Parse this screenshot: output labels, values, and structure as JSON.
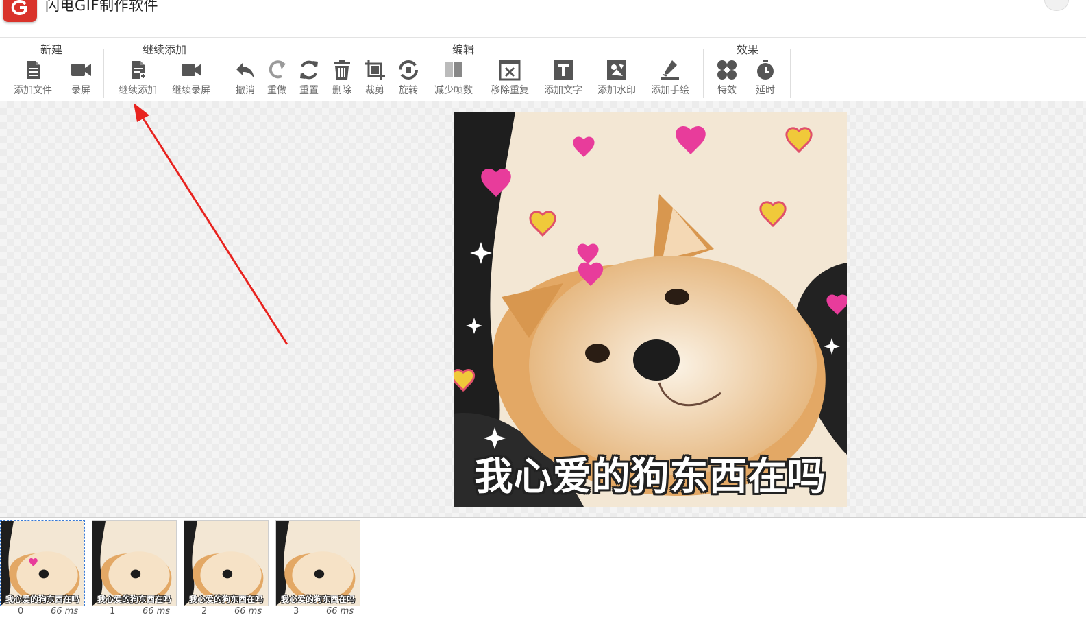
{
  "app": {
    "title": "闪电GIF制作软件"
  },
  "toolbar": {
    "groups": [
      {
        "title": "新建",
        "tools": [
          {
            "label": "添加文件",
            "icon": "file-icon"
          },
          {
            "label": "录屏",
            "icon": "camera-icon"
          }
        ]
      },
      {
        "title": "继续添加",
        "tools": [
          {
            "label": "继续添加",
            "icon": "file-add-icon"
          },
          {
            "label": "继续录屏",
            "icon": "camera-icon"
          }
        ]
      },
      {
        "title": "编辑",
        "tools": [
          {
            "label": "撤消",
            "icon": "undo-icon"
          },
          {
            "label": "重做",
            "icon": "redo-icon"
          },
          {
            "label": "重置",
            "icon": "refresh-icon"
          },
          {
            "label": "删除",
            "icon": "trash-icon"
          },
          {
            "label": "裁剪",
            "icon": "crop-icon"
          },
          {
            "label": "旋转",
            "icon": "rotate-icon"
          },
          {
            "label": "减少帧数",
            "icon": "reduce-frames-icon"
          },
          {
            "label": "移除重复",
            "icon": "remove-duplicate-icon"
          },
          {
            "label": "添加文字",
            "icon": "text-icon"
          },
          {
            "label": "添加水印",
            "icon": "watermark-icon"
          },
          {
            "label": "添加手绘",
            "icon": "pen-icon"
          }
        ]
      },
      {
        "title": "效果",
        "tools": [
          {
            "label": "特效",
            "icon": "effects-icon"
          },
          {
            "label": "延时",
            "icon": "timer-icon"
          }
        ]
      }
    ]
  },
  "preview": {
    "caption": "我心爱的狗东西在吗"
  },
  "frames": [
    {
      "index": "0",
      "duration": "66 ms",
      "caption": "我心爱的狗东西在吗"
    },
    {
      "index": "1",
      "duration": "66 ms",
      "caption": "我心爱的狗东西在吗"
    },
    {
      "index": "2",
      "duration": "66 ms",
      "caption": "我心爱的狗东西在吗"
    },
    {
      "index": "3",
      "duration": "66 ms",
      "caption": "我心爱的狗东西在吗"
    }
  ],
  "colors": {
    "brand": "#d9332b",
    "arrow": "#e8231f",
    "icon": "#555555"
  }
}
